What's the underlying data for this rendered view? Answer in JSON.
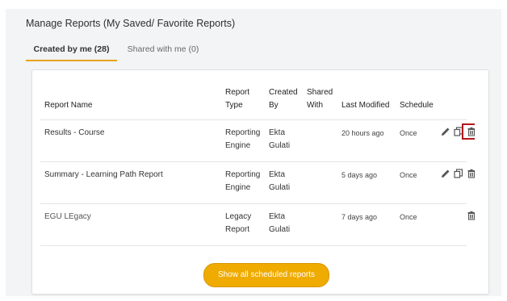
{
  "page": {
    "title": "Manage Reports (My Saved/ Favorite Reports)"
  },
  "tabs": [
    {
      "label": "Created by me (28)",
      "active": true
    },
    {
      "label": "Shared with me (0)",
      "active": false
    }
  ],
  "table": {
    "headers": {
      "report_name": "Report Name",
      "report_type_1": "Report",
      "report_type_2": "Type",
      "created_by_1": "Created",
      "created_by_2": "By",
      "shared_with_1": "Shared",
      "shared_with_2": "With",
      "last_modified": "Last Modified",
      "schedule": "Schedule"
    },
    "rows": [
      {
        "name": "Results - Course",
        "type_1": "Reporting",
        "type_2": "Engine",
        "created_1": "Ekta",
        "created_2": "Gulati",
        "shared": "",
        "modified": "20 hours ago",
        "schedule": "Once",
        "actions": [
          "edit",
          "copy",
          "delete"
        ]
      },
      {
        "name": "Summary - Learning Path Report",
        "type_1": "Reporting",
        "type_2": "Engine",
        "created_1": "Ekta",
        "created_2": "Gulati",
        "shared": "",
        "modified": "5 days ago",
        "schedule": "Once",
        "actions": [
          "edit",
          "copy",
          "delete"
        ]
      },
      {
        "name": "EGU LEgacy",
        "type_1": "Legacy",
        "type_2": "Report",
        "created_1": "Ekta",
        "created_2": "Gulati",
        "shared": "",
        "modified": "7 days ago",
        "schedule": "Once",
        "actions": [
          "delete"
        ]
      }
    ]
  },
  "footer": {
    "show_all_label": "Show all scheduled reports"
  },
  "colors": {
    "accent": "#f0ab00",
    "highlight": "#b3161c",
    "panel_bg": "#f2f4f5"
  },
  "icons": {
    "edit": "pencil-icon",
    "copy": "copy-icon",
    "delete": "trash-icon"
  }
}
